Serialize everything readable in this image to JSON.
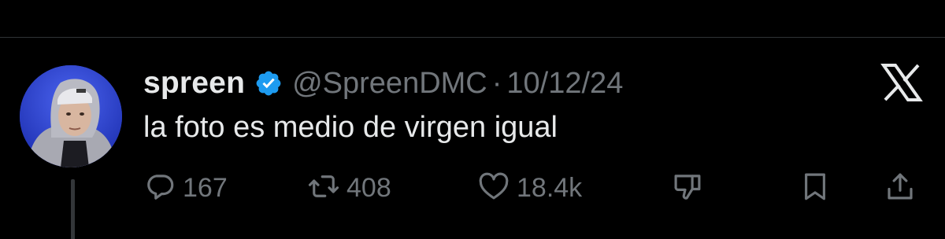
{
  "tweet": {
    "author": {
      "display_name": "spreen",
      "handle": "@SpreenDMC",
      "verified": true
    },
    "separator": "·",
    "date": "10/12/24",
    "text": "la foto es medio de virgen igual",
    "stats": {
      "replies": "167",
      "retweets": "408",
      "likes": "18.4k"
    }
  },
  "colors": {
    "background": "#000000",
    "primary_text": "#e7e9ea",
    "secondary_text": "#71767b",
    "verified_badge": "#1d9bf0",
    "divider": "#2f3336"
  },
  "icons": {
    "verified": "verified-badge-icon",
    "brand": "x-logo-icon",
    "reply": "reply-icon",
    "retweet": "retweet-icon",
    "like": "heart-icon",
    "dislike": "thumbs-down-icon",
    "bookmark": "bookmark-icon",
    "share": "share-icon"
  }
}
